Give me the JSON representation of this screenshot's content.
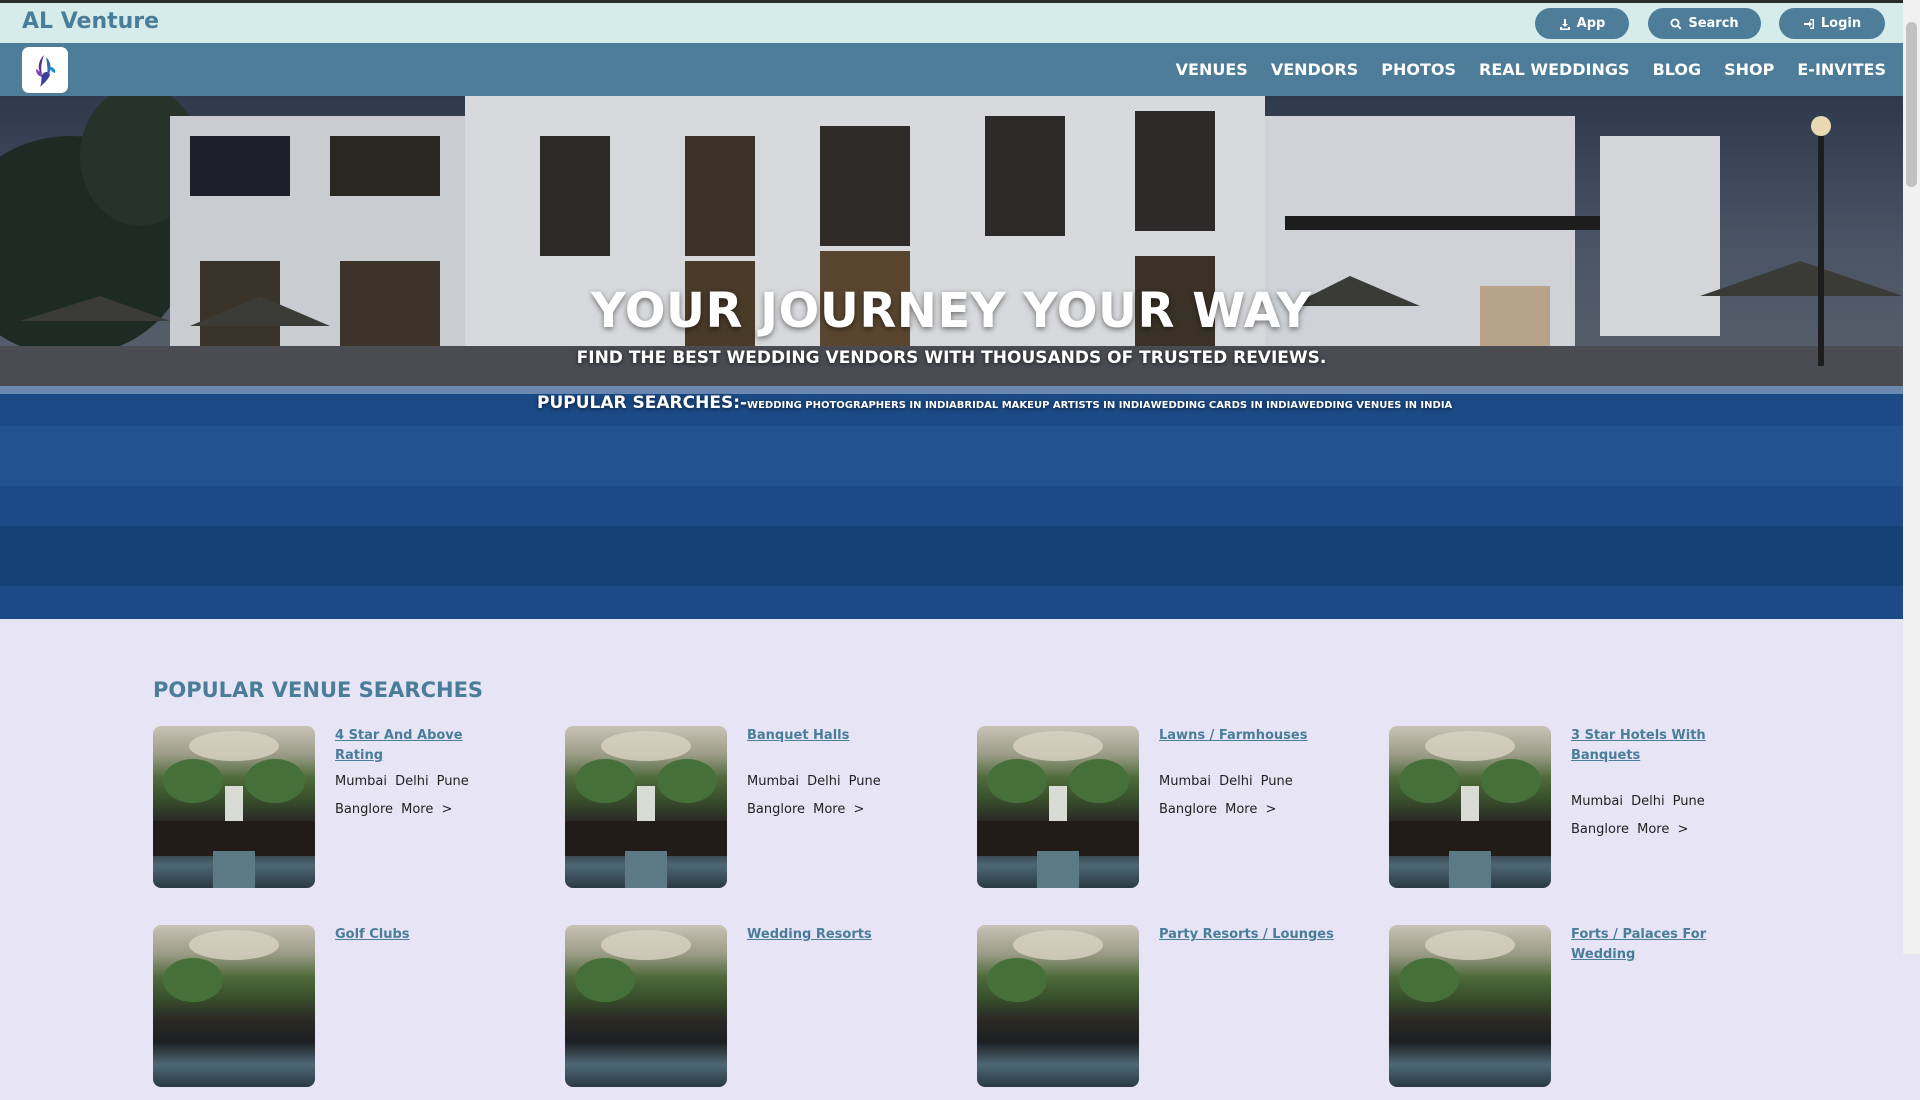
{
  "topbar": {
    "brand": "AL Venture",
    "buttons": [
      {
        "label": "App",
        "icon": "download-icon"
      },
      {
        "label": "Search",
        "icon": "search-icon"
      },
      {
        "label": "Login",
        "icon": "login-icon"
      }
    ]
  },
  "nav": {
    "items": [
      "VENUES",
      "VENDORS",
      "PHOTOS",
      "REAL WEDDINGS",
      "BLOG",
      "SHOP",
      "E-INVITES"
    ]
  },
  "hero": {
    "title": "YOUR JOURNEY YOUR WAY",
    "subtitle": "FIND THE BEST WEDDING VENDORS WITH THOUSANDS OF TRUSTED REVIEWS.",
    "popular_label": "PUPULAR SEARCHES:-",
    "popular_links": [
      "WEDDING PHOTOGRAPHERS IN INDIA",
      "BRIDAL MAKEUP ARTISTS IN INDIA",
      "WEDDING CARDS IN INDIA",
      "WEDDING VENUES IN INDIA"
    ]
  },
  "section": {
    "title": "POPULAR VENUE SEARCHES",
    "cards": [
      {
        "title": "4 Star And Above Rating",
        "cities_line1": "Mumbai Delhi Pune",
        "cities_line2": "Banglore More >"
      },
      {
        "title": "Banquet Halls",
        "cities_line1": "Mumbai Delhi Pune",
        "cities_line2": "Banglore More >"
      },
      {
        "title": "Lawns / Farmhouses",
        "cities_line1": "Mumbai Delhi Pune",
        "cities_line2": "Banglore More >"
      },
      {
        "title": "3 Star Hotels With Banquets",
        "cities_line1": "Mumbai Delhi Pune",
        "cities_line2": "Banglore More >"
      },
      {
        "title": "Golf Clubs"
      },
      {
        "title": "Wedding Resorts"
      },
      {
        "title": "Party Resorts / Lounges"
      },
      {
        "title": "Forts / Palaces For Wedding"
      }
    ]
  },
  "colors": {
    "accent": "#4d7d99",
    "topbar_bg": "#d6eceb",
    "page_bg": "#e6e4f5"
  }
}
